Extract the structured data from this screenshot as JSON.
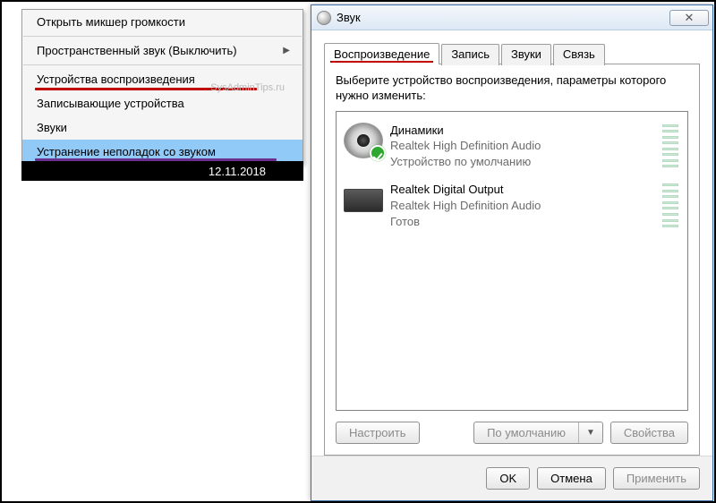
{
  "context_menu": {
    "items": [
      {
        "label": "Открыть микшер громкости",
        "submenu": false
      },
      {
        "label": "Пространственный звук (Выключить)",
        "submenu": true
      },
      {
        "label": "Устройства воспроизведения",
        "submenu": false,
        "underline": "red"
      },
      {
        "label": "Записывающие устройства",
        "submenu": false
      },
      {
        "label": "Звуки",
        "submenu": false
      },
      {
        "label": "Устранение неполадок со звуком",
        "submenu": false,
        "highlighted": true,
        "underline": "purple"
      }
    ],
    "watermark": "SysAdminTips.ru"
  },
  "taskbar": {
    "date": "12.11.2018"
  },
  "sound_dialog": {
    "title": "Звук",
    "close_glyph": "✕",
    "tabs": [
      "Воспроизведение",
      "Запись",
      "Звуки",
      "Связь"
    ],
    "active_tab_index": 0,
    "instruction": "Выберите устройство воспроизведения, параметры которого нужно изменить:",
    "devices": [
      {
        "name": "Динамики",
        "sub1": "Realtek High Definition Audio",
        "sub2": "Устройство по умолчанию",
        "icon": "speaker",
        "default_badge": true
      },
      {
        "name": "Realtek Digital Output",
        "sub1": "Realtek High Definition Audio",
        "sub2": "Готов",
        "icon": "digital",
        "default_badge": false
      }
    ],
    "panel_buttons": {
      "configure": "Настроить",
      "default": "По умолчанию",
      "properties": "Свойства"
    },
    "footer_buttons": {
      "ok": "OK",
      "cancel": "Отмена",
      "apply": "Применить"
    }
  }
}
